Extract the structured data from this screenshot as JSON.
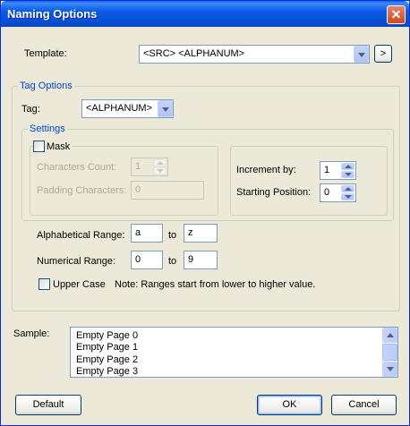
{
  "window": {
    "title": "Naming Options",
    "close_glyph": "✕"
  },
  "template": {
    "label": "Template:",
    "value": "<SRC> <ALPHANUM>",
    "browse_label": ">"
  },
  "tag_options": {
    "group_title": "Tag Options",
    "tag_label": "Tag:",
    "tag_value": "<ALPHANUM>",
    "settings": {
      "group_title": "Settings",
      "mask_label": "Mask",
      "mask_checked": false,
      "characters_count_label": "Characters Count:",
      "characters_count_value": "1",
      "padding_characters_label": "Padding Characters:",
      "padding_characters_value": "0",
      "increment_by_label": "Increment by:",
      "increment_by_value": "1",
      "starting_position_label": "Starting Position:",
      "starting_position_value": "0"
    },
    "alphabetical_range": {
      "label": "Alphabetical Range:",
      "from": "a",
      "to_label": "to",
      "to": "z"
    },
    "numerical_range": {
      "label": "Numerical Range:",
      "from": "0",
      "to_label": "to",
      "to": "9"
    },
    "upper_case_label": "Upper Case",
    "upper_case_checked": false,
    "note": "Note: Ranges start from lower to higher value."
  },
  "sample": {
    "label": "Sample:",
    "items": [
      "Empty Page 0",
      "Empty Page 1",
      "Empty Page 2",
      "Empty Page 3"
    ]
  },
  "buttons": {
    "default": "Default",
    "ok": "OK",
    "cancel": "Cancel"
  },
  "colors": {
    "title_bar": "#0a5ae6",
    "dialog_bg": "#ece9d8",
    "group_title": "#0046d5",
    "close_button": "#d0461f"
  }
}
